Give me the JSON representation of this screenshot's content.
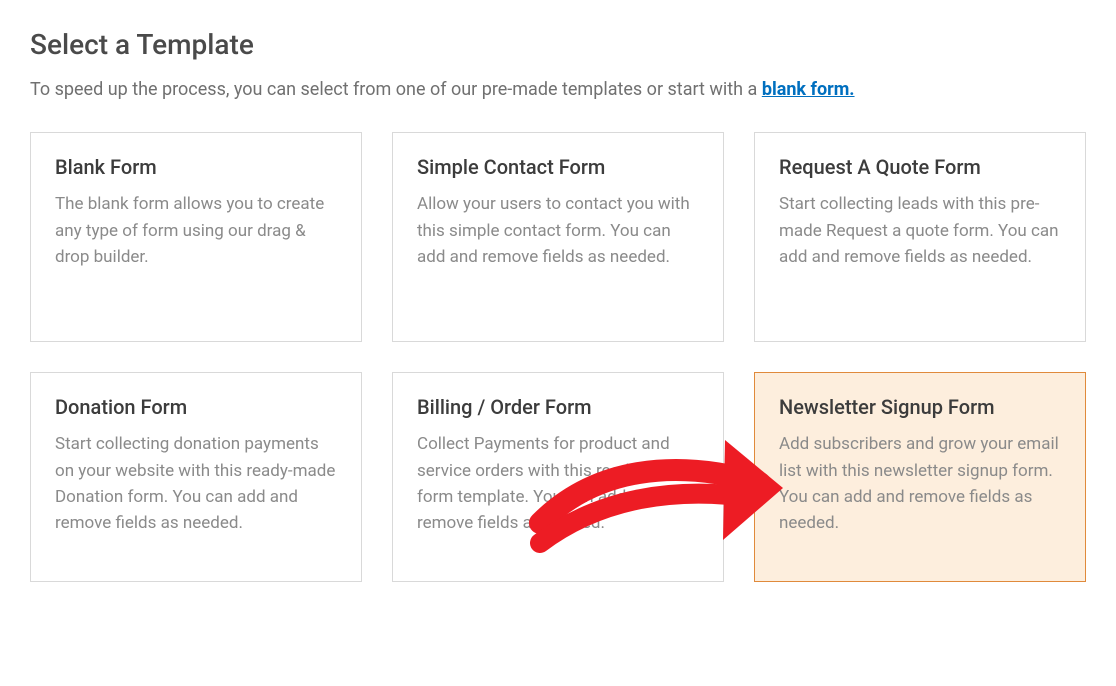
{
  "header": {
    "title": "Select a Template",
    "subtext_before_link": "To speed up the process, you can select from one of our pre-made templates or start with a ",
    "link_label": "blank form."
  },
  "templates": [
    {
      "title": "Blank Form",
      "desc": "The blank form allows you to create any type of form using our drag & drop builder.",
      "highlight": false
    },
    {
      "title": "Simple Contact Form",
      "desc": "Allow your users to contact you with this simple contact form. You can add and remove fields as needed.",
      "highlight": false
    },
    {
      "title": "Request A Quote Form",
      "desc": "Start collecting leads with this pre-made Request a quote form. You can add and remove fields as needed.",
      "highlight": false
    },
    {
      "title": "Donation Form",
      "desc": "Start collecting donation payments on your website with this ready-made Donation form. You can add and remove fields as needed.",
      "highlight": false
    },
    {
      "title": "Billing / Order Form",
      "desc": "Collect Payments for product and service orders with this ready-made form template. You can add and remove fields as needed.",
      "highlight": false
    },
    {
      "title": "Newsletter Signup Form",
      "desc": "Add subscribers and grow your email list with this newsletter signup form. You can add and remove fields as needed.",
      "highlight": true
    }
  ]
}
